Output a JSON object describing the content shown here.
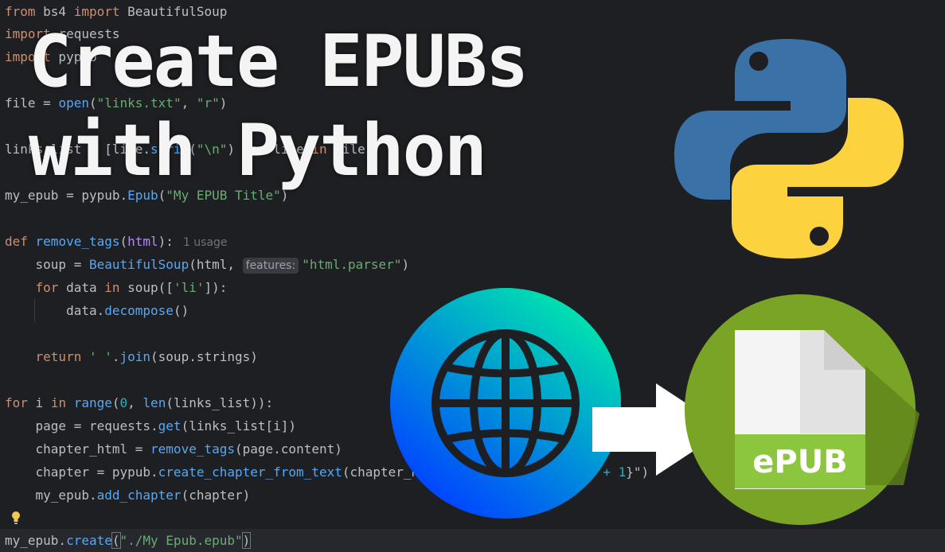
{
  "title": {
    "line1": "Create EPUBs",
    "line2": "with Python"
  },
  "code": {
    "l1_from": "from",
    "l1_mod": " bs4 ",
    "l1_import": "import",
    "l1_name": " BeautifulSoup",
    "l2_import": "import",
    "l2_name": " requests",
    "l3_import": "import",
    "l3_name": " pypub",
    "l5_a": "file = ",
    "l5_fn": "open",
    "l5_b": "(",
    "l5_s1": "\"links.txt\"",
    "l5_c": ", ",
    "l5_s2": "\"r\"",
    "l5_d": ")",
    "l7_a": "links_list = [line.",
    "l7_fn": "strip",
    "l7_b": "(",
    "l7_s": "\"\\n\"",
    "l7_c": ") ",
    "l7_for": "for",
    "l7_d": " line ",
    "l7_in": "in",
    "l7_e": " file]",
    "l9_a": "my_epub = pypub.",
    "l9_fn": "Epub",
    "l9_b": "(",
    "l9_s": "\"My EPUB Title\"",
    "l9_c": ")",
    "l11_def": "def",
    "l11_fn": " remove_tags",
    "l11_a": "(",
    "l11_par": "html",
    "l11_b": "):",
    "l11_hint": "1 usage",
    "l12_a": "    soup = ",
    "l12_fn": "BeautifulSoup",
    "l12_b": "(html, ",
    "l12_inlay": "features:",
    "l12_s": "\"html.parser\"",
    "l12_c": ")",
    "l13_for": "    for",
    "l13_a": " data ",
    "l13_in": "in",
    "l13_b": " soup([",
    "l13_s": "'li'",
    "l13_c": "]):",
    "l14_a": "        data.",
    "l14_fn": "decompose",
    "l14_b": "()",
    "l16_ret": "    return",
    "l16_s": " ' '",
    "l16_a": ".",
    "l16_fn": "join",
    "l16_b": "(soup.strings)",
    "l18_for": "for",
    "l18_a": " i ",
    "l18_in": "in",
    "l18_fn": " range",
    "l18_b": "(",
    "l18_n": "0",
    "l18_c": ", ",
    "l18_fn2": "len",
    "l18_d": "(links_list)):",
    "l19_a": "    page = requests.",
    "l19_fn": "get",
    "l19_b": "(links_list[i])",
    "l20_a": "    chapter_html = ",
    "l20_fn": "remove_tags",
    "l20_b": "(page.content)",
    "l21_a": "    chapter = pypub.",
    "l21_fn": "create_chapter_from_text",
    "l21_b": "(chapter_html, title=f\"Chapter ",
    "l21_c": "{i + ",
    "l21_n": "1",
    "l21_d": "}\")",
    "l22_a": "    my_epub.",
    "l22_fn": "add_chapter",
    "l22_b": "(chapter)",
    "l24_a": "my_epub.",
    "l24_fn": "create",
    "l24_b": "(",
    "l24_s": "\"./My Epub.epub\"",
    "l24_c": ")"
  },
  "logos": {
    "python": "python-logo",
    "globe": "globe-icon",
    "arrow": "arrow-right-icon",
    "epub_label": "ePUB"
  },
  "colors": {
    "background": "#1e1f22",
    "keyword": "#cf8e6d",
    "function": "#56a8f5",
    "string": "#6aab73",
    "number": "#2aacb8",
    "python_blue": "#3a71a6",
    "python_yellow": "#fdd23f",
    "epub_green": "#7aa425",
    "globe_gradient_start": "#00e0b0",
    "globe_gradient_end": "#0047ff"
  }
}
